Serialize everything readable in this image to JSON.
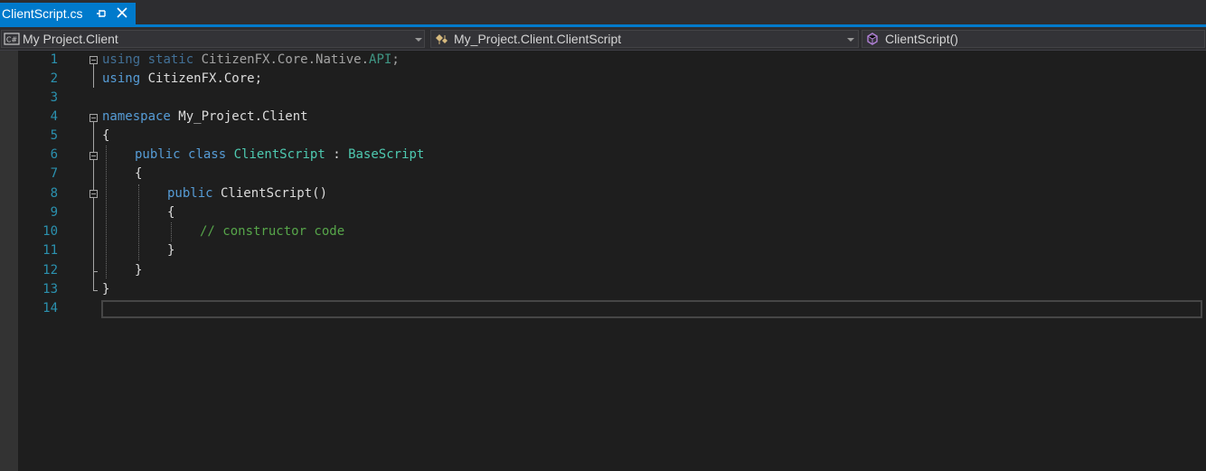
{
  "tab": {
    "title": "ClientScript.cs",
    "pin_icon": "pin-icon",
    "close_icon": "close-icon"
  },
  "navbar": {
    "project": {
      "label": "My Project.Client",
      "icon": "csharp-project-icon"
    },
    "type": {
      "label": "My_Project.Client.ClientScript",
      "icon": "class-icon"
    },
    "member": {
      "label": "ClientScript()",
      "icon": "method-icon"
    }
  },
  "editor": {
    "line_numbers": [
      "1",
      "2",
      "3",
      "4",
      "5",
      "6",
      "7",
      "8",
      "9",
      "10",
      "11",
      "12",
      "13",
      "14"
    ],
    "lines": {
      "l1": {
        "kw1": "using",
        "kw2": "static",
        "ns": " CitizenFX.Core.Native.",
        "api": "API",
        "semi": ";"
      },
      "l2": {
        "kw": "using",
        "rest": " CitizenFX.Core;"
      },
      "l4": {
        "kw": "namespace",
        "rest": " My_Project.Client"
      },
      "l5": {
        "text": "{"
      },
      "l6": {
        "kw1": "public",
        "kw2": "class",
        "name": "ClientScript",
        "colon": " : ",
        "base": "BaseScript"
      },
      "l7": {
        "text": "{"
      },
      "l8": {
        "kw": "public",
        "rest": " ClientScript()"
      },
      "l9": {
        "text": "{"
      },
      "l10": {
        "comment": "// constructor code"
      },
      "l11": {
        "text": "}"
      },
      "l12": {
        "text": "}"
      },
      "l13": {
        "text": "}"
      }
    }
  },
  "colors": {
    "accent": "#007acc",
    "keyword": "#569cd6",
    "type": "#4ec9b0",
    "comment": "#57a64a",
    "line_number": "#2b91af"
  }
}
